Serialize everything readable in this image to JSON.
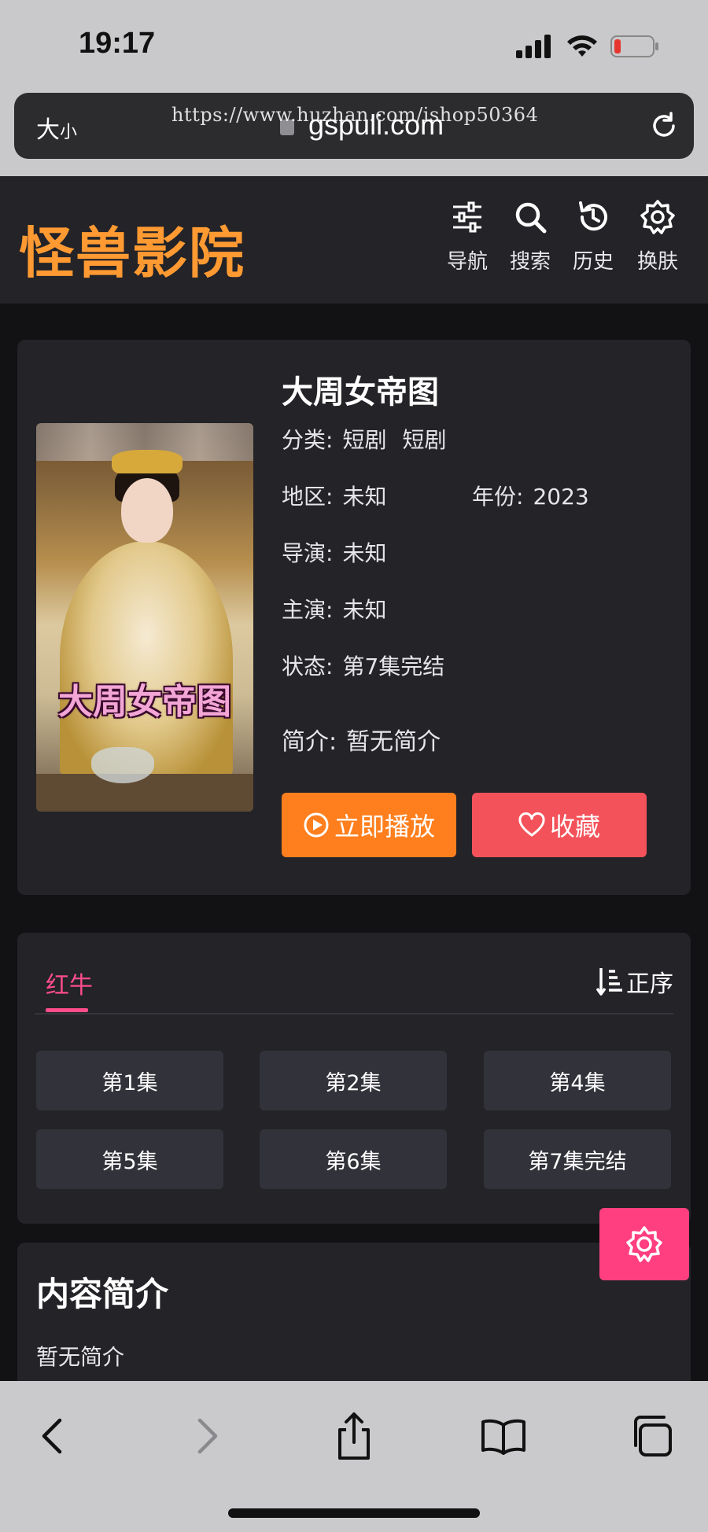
{
  "status_bar": {
    "time": "19:17"
  },
  "browser": {
    "text_size_label_big": "大",
    "text_size_label_small": "小",
    "domain": "gspuli.com",
    "watermark": "https://www.huzhan.com/ishop50364"
  },
  "site": {
    "logo": "怪兽影院",
    "nav": [
      {
        "label": "导航",
        "icon": "sliders-icon"
      },
      {
        "label": "搜索",
        "icon": "search-icon"
      },
      {
        "label": "历史",
        "icon": "history-icon"
      },
      {
        "label": "换肤",
        "icon": "gear-icon"
      }
    ]
  },
  "detail": {
    "poster_title": "大周女帝图",
    "title": "大周女帝图",
    "category_label": "分类:",
    "category_value1": "短剧",
    "category_value2": "短剧",
    "region_label": "地区:",
    "region_value": "未知",
    "year_label": "年份:",
    "year_value": "2023",
    "director_label": "导演:",
    "director_value": "未知",
    "cast_label": "主演:",
    "cast_value": "未知",
    "status_label": "状态:",
    "status_value": "第7集完结",
    "summary_label": "简介:",
    "summary_value": "暂无简介",
    "play_label": "立即播放",
    "favorite_label": "收藏"
  },
  "episodes": {
    "source_tab": "红牛",
    "sort_label": "正序",
    "items": [
      "第1集",
      "第2集",
      "第4集",
      "第5集",
      "第6集",
      "第7集完结"
    ]
  },
  "intro": {
    "title": "内容简介",
    "text": "暂无简介"
  },
  "colors": {
    "logo": "#ff9a32",
    "play_button": "#ff7f1e",
    "favorite_button": "#f4525a",
    "accent_pink": "#ff4d8a",
    "float_button": "#ff3f80"
  }
}
